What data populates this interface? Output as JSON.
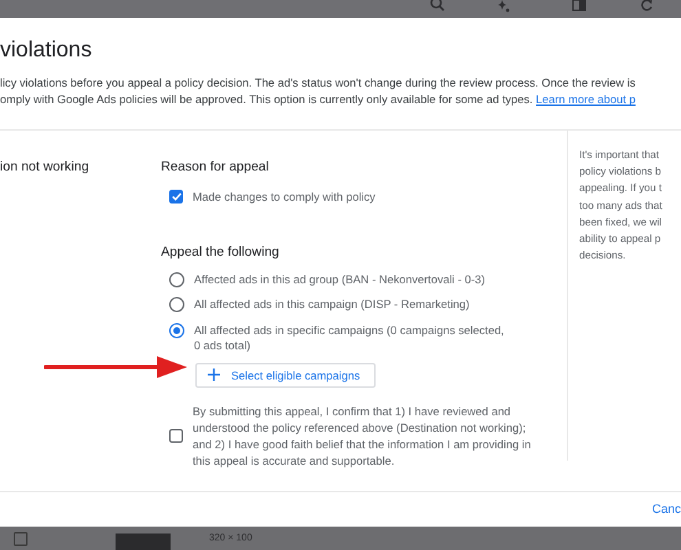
{
  "dialog": {
    "title": "violations",
    "description": "licy violations before you appeal a policy decision. The ad's status won't change during the review process. Once the review is\nomply with Google Ads policies will be approved. This option is currently only available for some ad types. ",
    "link": "Learn more about p"
  },
  "policy": "ion not working",
  "reason": {
    "heading": "Reason for appeal",
    "options": [
      {
        "label": "Made changes to comply with policy",
        "checked": true
      }
    ]
  },
  "appeal": {
    "heading": "Appeal the following",
    "options": [
      {
        "label": "Affected ads in this ad group (BAN - Nekonvertovali - 0-3)",
        "selected": false
      },
      {
        "label": "All affected ads in this campaign (DISP - Remarketing)",
        "selected": false
      },
      {
        "label": "All affected ads in specific campaigns (0 campaigns selected, 0 ads total)",
        "selected": true
      }
    ],
    "button": "Select eligible campaigns"
  },
  "consent": {
    "text": "By submitting this appeal, I confirm that 1) I have reviewed and understood the policy referenced above (Destination not working); and 2) I have good faith belief that the information I am providing in this appeal is accurate and supportable.",
    "checked": false
  },
  "sidebar": {
    "text": "It's important that\npolicy violations b\nappealing. If you t\ntoo many ads that\nbeen fixed, we wil\nability to appeal p\ndecisions."
  },
  "footer": {
    "buttons": [
      "Canc"
    ]
  },
  "background": {
    "size": "320 × 100",
    "row_checked": false
  }
}
